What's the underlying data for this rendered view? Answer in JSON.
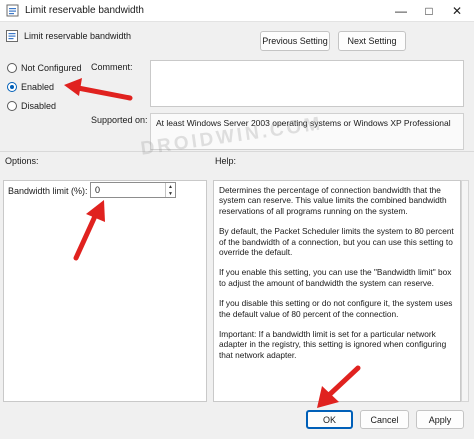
{
  "window": {
    "title": "Limit reservable bandwidth",
    "minimize_glyph": "—",
    "maximize_glyph": "□",
    "close_glyph": "✕"
  },
  "policy": {
    "name": "Limit reservable bandwidth"
  },
  "nav": {
    "previous_label": "Previous Setting",
    "next_label": "Next Setting"
  },
  "state": {
    "options": [
      {
        "label": "Not Configured",
        "checked": false
      },
      {
        "label": "Enabled",
        "checked": true
      },
      {
        "label": "Disabled",
        "checked": false
      }
    ]
  },
  "comment": {
    "label": "Comment:",
    "value": ""
  },
  "supported": {
    "label": "Supported on:",
    "value": "At least Windows Server 2003 operating systems or Windows XP Professional"
  },
  "options_section": {
    "label": "Options:"
  },
  "help_section": {
    "label": "Help:"
  },
  "bandwidth": {
    "label": "Bandwidth limit (%):",
    "value": "0"
  },
  "help": {
    "paragraphs": [
      "Determines the percentage of connection bandwidth that the system can reserve. This value limits the combined bandwidth reservations of all programs running on the system.",
      "By default, the Packet Scheduler limits the system to 80 percent of the bandwidth of a connection, but you can use this setting to override the default.",
      "If you enable this setting, you can use the \"Bandwidth limit\" box to adjust the amount of bandwidth the system can reserve.",
      "If you disable this setting or do not configure it, the system uses the default value of 80 percent of the connection.",
      "Important: If a bandwidth limit is set for a particular network adapter in the registry, this setting is ignored when configuring that network adapter."
    ]
  },
  "footer": {
    "ok_label": "OK",
    "cancel_label": "Cancel",
    "apply_label": "Apply"
  },
  "watermark": {
    "text": "DROIDWIN.COM"
  },
  "colors": {
    "accent": "#005fb8",
    "annotation_arrow": "#e0221f"
  }
}
